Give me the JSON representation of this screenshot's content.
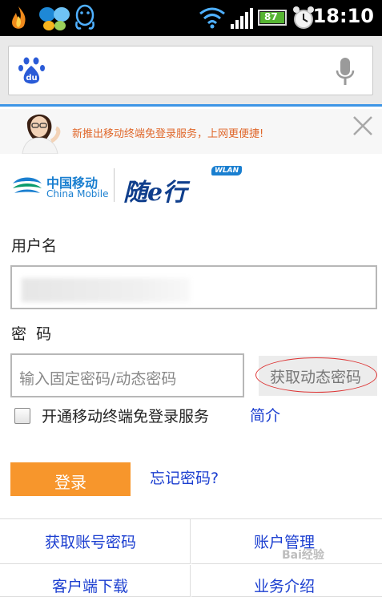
{
  "status_bar": {
    "time": "18:10",
    "battery_level": "87",
    "icons": [
      "flame-app-icon",
      "butterfly-app-icon",
      "qq-penguin-icon",
      "wifi-icon",
      "signal-icon",
      "battery-icon",
      "alarm-clock-icon"
    ]
  },
  "browser": {
    "search_icon": "baidu-paw-logo",
    "voice_icon": "microphone-icon",
    "logo_text": "du"
  },
  "ad_banner": {
    "text": "新推出移动终端免登录服务，上网更便捷!",
    "close_icon": "close-x-icon"
  },
  "branding": {
    "carrier_cn": "中国移动",
    "carrier_en": "China Mobile",
    "service_name": "随e行",
    "badge": "WLAN"
  },
  "form": {
    "username_label": "用户名",
    "username_value": "",
    "password_label": "密  码",
    "password_placeholder": "输入固定密码/动态密码",
    "dynamic_password_button": "获取动态密码",
    "auto_login_label": "开通移动终端免登录服务",
    "auto_login_checked": false,
    "intro_link": "简介",
    "login_button": "登录",
    "forgot_link": "忘记密码?"
  },
  "links": [
    "获取账号密码",
    "账户管理",
    "客户端下载",
    "业务介绍"
  ],
  "watermark": "Bai经验",
  "colors": {
    "accent": "#3d95e6",
    "login_button": "#f7962c",
    "link": "#1c3fd0",
    "ad_text": "#e0672a",
    "annotation_ellipse": "#dd3333"
  }
}
